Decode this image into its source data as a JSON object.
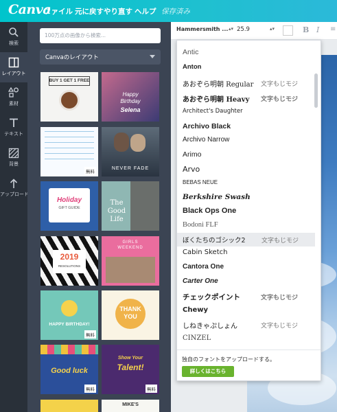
{
  "app": {
    "logo": "Canva"
  },
  "menu": [
    {
      "label": "ファイル"
    },
    {
      "label": "元に戻す"
    },
    {
      "label": "やり直す"
    },
    {
      "label": "ヘルプ"
    },
    {
      "label": "保存済み"
    }
  ],
  "nav": [
    {
      "label": "検索",
      "icon": "search-icon"
    },
    {
      "label": "レイアウト",
      "icon": "layout-icon"
    },
    {
      "label": "素材",
      "icon": "elements-icon"
    },
    {
      "label": "テキスト",
      "icon": "text-icon"
    },
    {
      "label": "背景",
      "icon": "background-icon"
    },
    {
      "label": "アップロード",
      "icon": "upload-icon"
    }
  ],
  "panel": {
    "search_placeholder": "100万点の画像から検索...",
    "dropdown": "Canvaのレイアウト",
    "free_badge": "無料",
    "thumbs": [
      {
        "lines": [
          "BUY 1 GET 1 FREE"
        ]
      },
      {
        "lines": [
          "Happy",
          "Birthday",
          "Selena"
        ]
      },
      {
        "lines": []
      },
      {
        "lines": [
          "NEVER FADE"
        ]
      },
      {
        "lines": [
          "Holiday",
          "GIFT GUIDE"
        ]
      },
      {
        "lines": [
          "The",
          "Good",
          "Life"
        ]
      },
      {
        "lines": [
          "2019",
          "RESOLUTIONS"
        ]
      },
      {
        "lines": [
          "GIRLS",
          "WEEKEND"
        ]
      },
      {
        "lines": [
          "HAPPY BIRTHDAY!"
        ]
      },
      {
        "lines": [
          "THANK",
          "YOU"
        ]
      },
      {
        "lines": [
          "Good luck"
        ]
      },
      {
        "lines": [
          "Show Your",
          "Talent!"
        ]
      },
      {
        "lines": []
      },
      {
        "lines": [
          "MIKE'S"
        ]
      }
    ]
  },
  "toolbar": {
    "font": "Hammersmith ...",
    "size": "25.9",
    "bold": "B",
    "italic": "I"
  },
  "fontlist": {
    "fonts": [
      {
        "name": "Antic",
        "jp": ""
      },
      {
        "name": "Anton",
        "jp": ""
      },
      {
        "name": "あおぞら明朝 Regular",
        "jp": "文字もじモジ"
      },
      {
        "name": "あおぞら明朝 Heavy",
        "jp": "文字もじモジ"
      },
      {
        "name": "Architect's Daughter",
        "jp": ""
      },
      {
        "name": "Archivo Black",
        "jp": ""
      },
      {
        "name": "Archivo Narrow",
        "jp": ""
      },
      {
        "name": "Arimo",
        "jp": ""
      },
      {
        "name": "Arvo",
        "jp": ""
      },
      {
        "name": "BEBAS NEUE",
        "jp": ""
      },
      {
        "name": "Berkshire Swash",
        "jp": ""
      },
      {
        "name": "Black Ops One",
        "jp": ""
      },
      {
        "name": "Bodoni FLF",
        "jp": ""
      },
      {
        "name": "ぼくたちのゴシック2",
        "jp": "文字もじモジ"
      },
      {
        "name": "Cabin Sketch",
        "jp": ""
      },
      {
        "name": "Cantora One",
        "jp": ""
      },
      {
        "name": "Carter One",
        "jp": ""
      },
      {
        "name": "チェックポイント",
        "jp": "文字もじモジ"
      },
      {
        "name": "Chewy",
        "jp": ""
      },
      {
        "name": "しねきゃぷしょん",
        "jp": "文字もじモジ"
      },
      {
        "name": "CINZEL",
        "jp": ""
      }
    ],
    "upload_text": "独自のフォントをアップロードする。",
    "upload_button": "詳しくはこちら"
  }
}
